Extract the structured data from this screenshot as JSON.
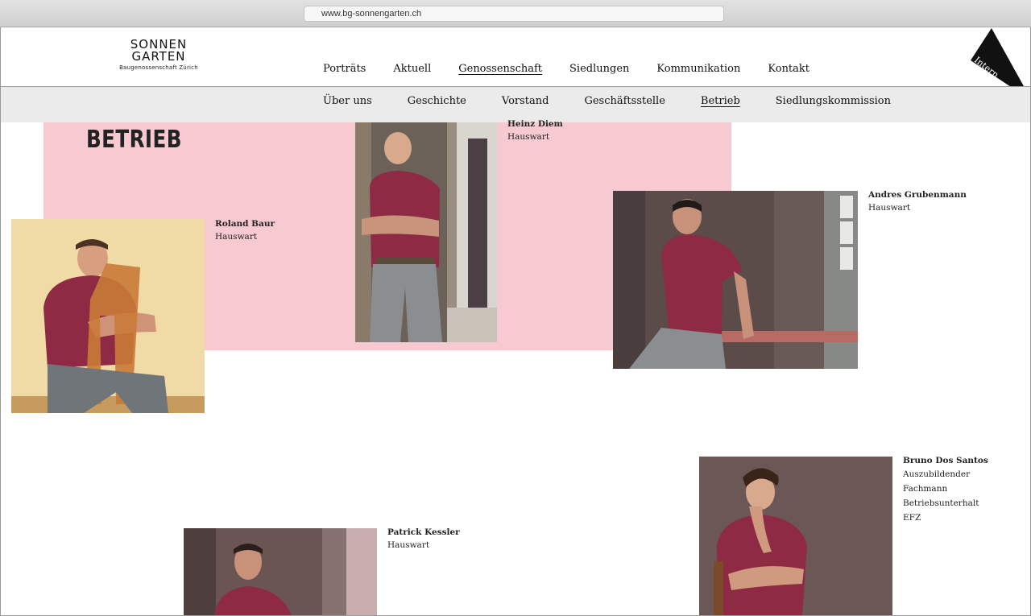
{
  "browser": {
    "url": "www.bg-sonnengarten.ch"
  },
  "logo": {
    "line1": "SONNEN",
    "line2": "GARTEN",
    "subtitle": "Baugenossenschaft Zürich"
  },
  "main_nav": [
    "Porträts",
    "Aktuell",
    "Genossenschaft",
    "Siedlungen",
    "Kommunikation",
    "Kontakt"
  ],
  "main_nav_active": "Genossenschaft",
  "intern_label": "Intern",
  "sub_nav": [
    "Über uns",
    "Geschichte",
    "Vorstand",
    "Geschäftsstelle",
    "Betrieb",
    "Siedlungskommission"
  ],
  "sub_nav_active": "Betrieb",
  "page_title": "BETRIEB",
  "people": [
    {
      "name": "Roland Baur",
      "role": "Hauswart"
    },
    {
      "name": "Heinz Diem",
      "role": "Hauswart"
    },
    {
      "name": "Andres Grubenmann",
      "role": "Hauswart"
    },
    {
      "name": "Bruno Dos Santos",
      "role_lines": [
        "Auszubildender",
        "Fachmann",
        "Betriebsunterhalt",
        "EFZ"
      ]
    },
    {
      "name": "Patrick Kessler",
      "role": "Hauswart"
    }
  ],
  "colors": {
    "pink": "#f7c9d1",
    "shirt": "#8e2a43",
    "subnav_bg": "#ebebeb"
  }
}
